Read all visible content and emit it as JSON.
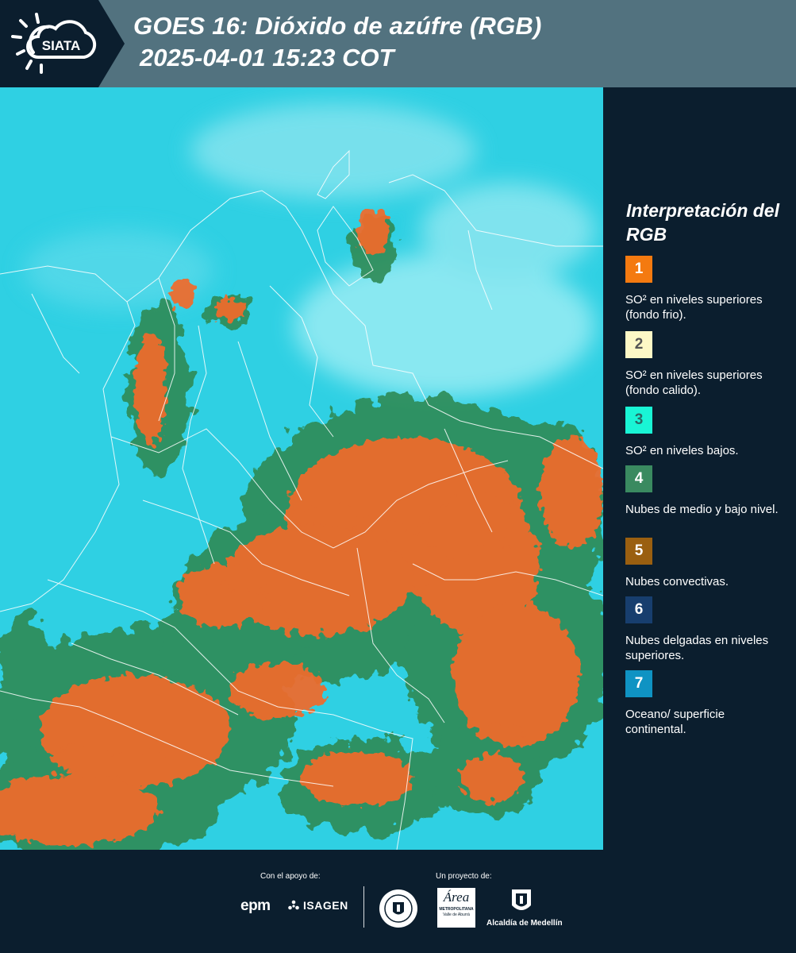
{
  "header": {
    "logo_text": "SIATA",
    "title": "GOES 16: Dióxido de azúfre (RGB)",
    "subtitle": "2025-04-01 15:23 COT"
  },
  "legend": {
    "title": "Interpretación del RGB",
    "items": [
      {
        "number": "1",
        "label": "SO² en niveles superiores (fondo frio).",
        "color": "#f47a10",
        "text_color": "#ffffff"
      },
      {
        "number": "2",
        "label": "SO² en niveles superiores (fondo calido).",
        "color": "#fdf8c6",
        "text_color": "#555555"
      },
      {
        "number": "3",
        "label": "SO² en niveles bajos.",
        "color": "#19f5d5",
        "text_color": "#2a6a66"
      },
      {
        "number": "4",
        "label": "Nubes de medio y bajo nivel.",
        "color": "#3a8a60",
        "text_color": "#ffffff"
      },
      {
        "number": "5",
        "label": "Nubes convectivas.",
        "color": "#9a5f10",
        "text_color": "#ffffff"
      },
      {
        "number": "6",
        "label": "Nubes delgadas en niveles superiores.",
        "color": "#173e6e",
        "text_color": "#ffffff"
      },
      {
        "number": "7",
        "label": "Oceano/ superficie continental.",
        "color": "#0f93c3",
        "text_color": "#ffffff"
      }
    ]
  },
  "footer": {
    "support_label": "Con el apoyo de:",
    "project_label": "Un proyecto de:",
    "sponsors": {
      "epm": "epm",
      "isagen": "ISAGEN",
      "area": "Área",
      "area_sub": "METROPOLITANA",
      "area_sub2": "Valle de Aburrá",
      "alcaldia": "Alcaldía de Medellín"
    }
  },
  "colors": {
    "background": "#0b1e2e",
    "header": "#52727f",
    "ocean": "#2fd0e3",
    "cloud_orange": "#f26a2a",
    "cloud_green": "#2f8a55"
  }
}
